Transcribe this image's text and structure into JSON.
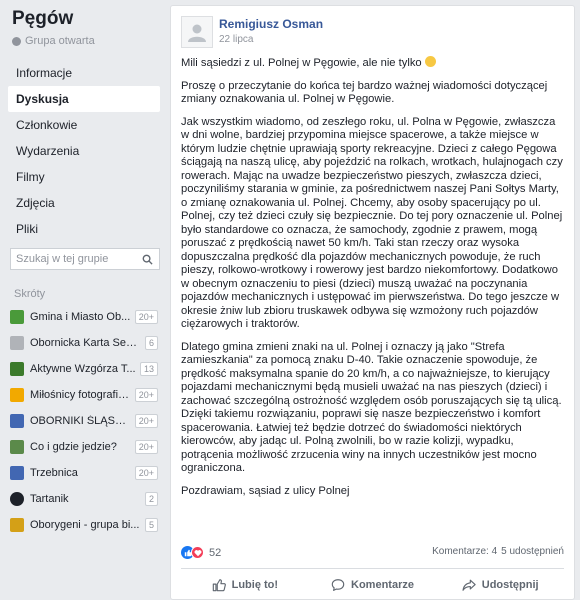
{
  "group": {
    "name": "Pęgów",
    "type": "Grupa otwarta"
  },
  "nav": {
    "items": [
      {
        "label": "Informacje"
      },
      {
        "label": "Dyskusja"
      },
      {
        "label": "Członkowie"
      },
      {
        "label": "Wydarzenia"
      },
      {
        "label": "Filmy"
      },
      {
        "label": "Zdjęcia"
      },
      {
        "label": "Pliki"
      }
    ],
    "active": "Dyskusja"
  },
  "search": {
    "placeholder": "Szukaj w tej grupie"
  },
  "shortcuts": {
    "header": "Skróty",
    "items": [
      {
        "label": "Gmina i Miasto Ob...",
        "badge": "20+",
        "color": "#4a9a3a"
      },
      {
        "label": "Obornicka Karta Sen...",
        "badge": "6",
        "color": "#b0b3b8"
      },
      {
        "label": "Aktywne Wzgórza T...",
        "badge": "13",
        "color": "#3b7a2b"
      },
      {
        "label": "Miłośnicy fotografii ...",
        "badge": "20+",
        "color": "#f2a900"
      },
      {
        "label": "OBORNIKI ŚLĄSKI...",
        "badge": "20+",
        "color": "#4267b2"
      },
      {
        "label": "Co i gdzie jedzie?",
        "badge": "20+",
        "color": "#5b8a4a"
      },
      {
        "label": "Trzebnica",
        "badge": "20+",
        "color": "#4267b2"
      },
      {
        "label": "Tartanik",
        "badge": "2",
        "color": "#1d2129"
      },
      {
        "label": "Oborygeni - grupa bi...",
        "badge": "5",
        "color": "#d4a017"
      }
    ]
  },
  "post": {
    "author": "Remigiusz Osman",
    "date": "22 lipca",
    "p1": "Mili sąsiedzi z ul. Polnej w Pęgowie, ale nie tylko",
    "p2": "Proszę o przeczytanie do końca tej bardzo ważnej wiadomości dotyczącej zmiany oznakowania ul. Polnej w Pęgowie.",
    "p3": "Jak wszystkim wiadomo, od zeszłego roku, ul. Polna w Pęgowie, zwłaszcza w dni wolne, bardziej przypomina miejsce spacerowe, a także miejsce w którym ludzie chętnie uprawiają sporty rekreacyjne. Dzieci z całego Pęgowa ściągają na naszą ulicę, aby pojeździć na rolkach, wrotkach, hulajnogach czy rowerach. Mając na uwadze bezpieczeństwo pieszych, zwłaszcza dzieci, poczyniliśmy starania w gminie, za pośrednictwem naszej Pani Sołtys Marty, o zmianę oznakowania ul. Polnej. Chcemy, aby osoby spacerujący po ul. Polnej, czy też dzieci czuły się bezpiecznie. Do tej pory oznaczenie ul. Polnej było standardowe co oznacza, że samochody, zgodnie z prawem, mogą poruszać z prędkością nawet 50 km/h. Taki stan rzeczy oraz wysoka dopuszczalna prędkość dla pojazdów mechanicznych powoduje, że ruch pieszy, rolkowo-wrotkowy i rowerowy jest bardzo niekomfortowy. Dodatkowo w obecnym oznaczeniu to piesi (dzieci) muszą uważać na poczynania pojazdów mechanicznych i ustępować im pierwszeństwa. Do tego jeszcze w okresie żniw lub zbioru truskawek odbywa się wzmożony ruch pojazdów ciężarowych i traktorów.",
    "p4": "Dlatego gmina zmieni znaki na ul. Polnej i oznaczy ją jako \"Strefa zamieszkania\" za pomocą znaku D-40. Takie oznaczenie spowoduje, że prędkość maksymalna spanie do 20 km/h, a co najważniejsze, to kierujący pojazdami mechanicznymi będą musieli uważać na nas pieszych (dzieci) i zachować szczególną ostrożność względem osób poruszających się tą ulicą. Dzięki takiemu rozwiązaniu, poprawi się nasze bezpieczeństwo i komfort spacerowania. Łatwiej też będzie dotrzeć do świadomości niektórych kierowców, aby jadąc ul. Polną zwolnili, bo w razie kolizji, wypadku, potrącenia możliwość zrzucenia winy na innych uczestników jest mocno ograniczona.",
    "p5": "Pozdrawiam, sąsiad z ulicy Polnej",
    "reaction_count": "52",
    "comments_stat": "Komentarze: 4",
    "shares_stat": "5 udostępnień",
    "actions": {
      "like": "Lubię to!",
      "comment": "Komentarze",
      "share": "Udostępnij"
    }
  }
}
